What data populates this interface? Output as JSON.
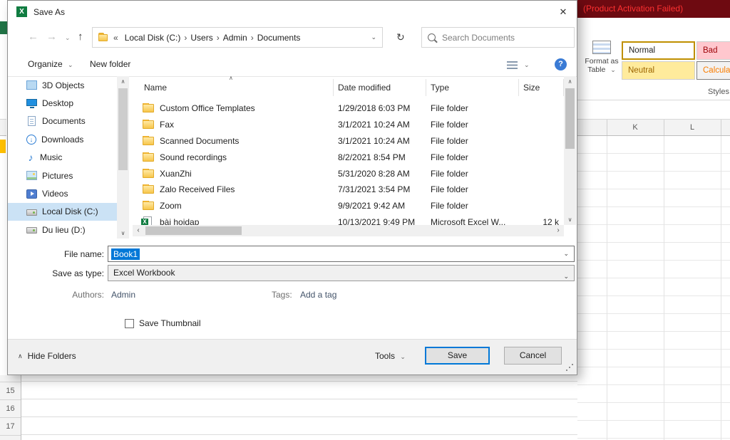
{
  "colors": {
    "accent": "#0078d7",
    "excel_green": "#107c41",
    "excel_titlebar_bg": "#6e0a11",
    "excel_titlebar_text": "#ff3131",
    "style_bad_bg": "#ffc7ce",
    "style_bad_text": "#9c0006",
    "style_neutral_bg": "#ffeb9c",
    "style_neutral_text": "#9c6500",
    "style_calc_text": "#fa7d00",
    "selection_bg": "#0078d7",
    "sidebar_selected_bg": "#cbe2f5"
  },
  "icons": {
    "app_logo": "X",
    "close": "✕",
    "back": "←",
    "forward": "→",
    "nav_dropdown": "⌄",
    "up": "↑",
    "refresh": "↻",
    "overflow": "«",
    "crumb_sep": "›",
    "addr_dropdown": "⌄",
    "organize_caret": "⌄",
    "view_caret": "⌄",
    "help": "?",
    "sort_asc": "∧",
    "scroll_up": "∧",
    "scroll_down": "∨",
    "scroll_left": "‹",
    "scroll_right": "›",
    "combo_caret": "⌄",
    "hide_caret": "∧",
    "tools_caret": "⌄",
    "fmt_caret": "⌄",
    "download_arrow": "↓",
    "music_note": "♪"
  },
  "excel": {
    "titlebar_text": "(Product Activation Failed)",
    "ribbon": {
      "format_as_table_line1": "Format as",
      "format_as_table_line2": "Table",
      "styles_group_label": "Styles",
      "style_cells": [
        {
          "label": "Normal"
        },
        {
          "label": "Bad"
        },
        {
          "label": "Neutral"
        },
        {
          "label": "Calculation"
        }
      ]
    },
    "column_headers": [
      "K",
      "L"
    ],
    "row_headers": [
      "15",
      "16",
      "17"
    ]
  },
  "dialog": {
    "title": "Save As",
    "nav": {
      "breadcrumb_items": [
        "Local Disk (C:)",
        "Users",
        "Admin",
        "Documents"
      ],
      "search_placeholder": "Search Documents"
    },
    "toolbar": {
      "organize": "Organize",
      "new_folder": "New folder"
    },
    "sidebar": [
      {
        "label": "3D Objects"
      },
      {
        "label": "Desktop"
      },
      {
        "label": "Documents"
      },
      {
        "label": "Downloads"
      },
      {
        "label": "Music"
      },
      {
        "label": "Pictures"
      },
      {
        "label": "Videos"
      },
      {
        "label": "Local Disk (C:)",
        "selected": true
      },
      {
        "label": "Du lieu (D:)"
      }
    ],
    "list": {
      "headers": [
        "Name",
        "Date modified",
        "Type",
        "Size"
      ],
      "rows": [
        {
          "name": "Custom Office Templates",
          "date": "1/29/2018 6:03 PM",
          "type": "File folder",
          "size": ""
        },
        {
          "name": "Fax",
          "date": "3/1/2021 10:24 AM",
          "type": "File folder",
          "size": ""
        },
        {
          "name": "Scanned Documents",
          "date": "3/1/2021 10:24 AM",
          "type": "File folder",
          "size": ""
        },
        {
          "name": "Sound recordings",
          "date": "8/2/2021 8:54 PM",
          "type": "File folder",
          "size": ""
        },
        {
          "name": "XuanZhi",
          "date": "5/31/2020 8:28 AM",
          "type": "File folder",
          "size": ""
        },
        {
          "name": "Zalo Received Files",
          "date": "7/31/2021 3:54 PM",
          "type": "File folder",
          "size": ""
        },
        {
          "name": "Zoom",
          "date": "9/9/2021 9:42 AM",
          "type": "File folder",
          "size": ""
        },
        {
          "name": "bài hoidap",
          "date": "10/13/2021 9:49 PM",
          "type": "Microsoft Excel W...",
          "size": "12 k"
        }
      ]
    },
    "fields": {
      "file_name_label": "File name:",
      "file_name_value": "Book1",
      "save_type_label": "Save as type:",
      "save_type_value": "Excel Workbook",
      "authors_label": "Authors:",
      "authors_value": "Admin",
      "tags_label": "Tags:",
      "tags_value": "Add a tag",
      "save_thumbnail_label": "Save Thumbnail"
    },
    "footer": {
      "hide_folders": "Hide Folders",
      "tools": "Tools",
      "save": "Save",
      "cancel": "Cancel"
    }
  }
}
